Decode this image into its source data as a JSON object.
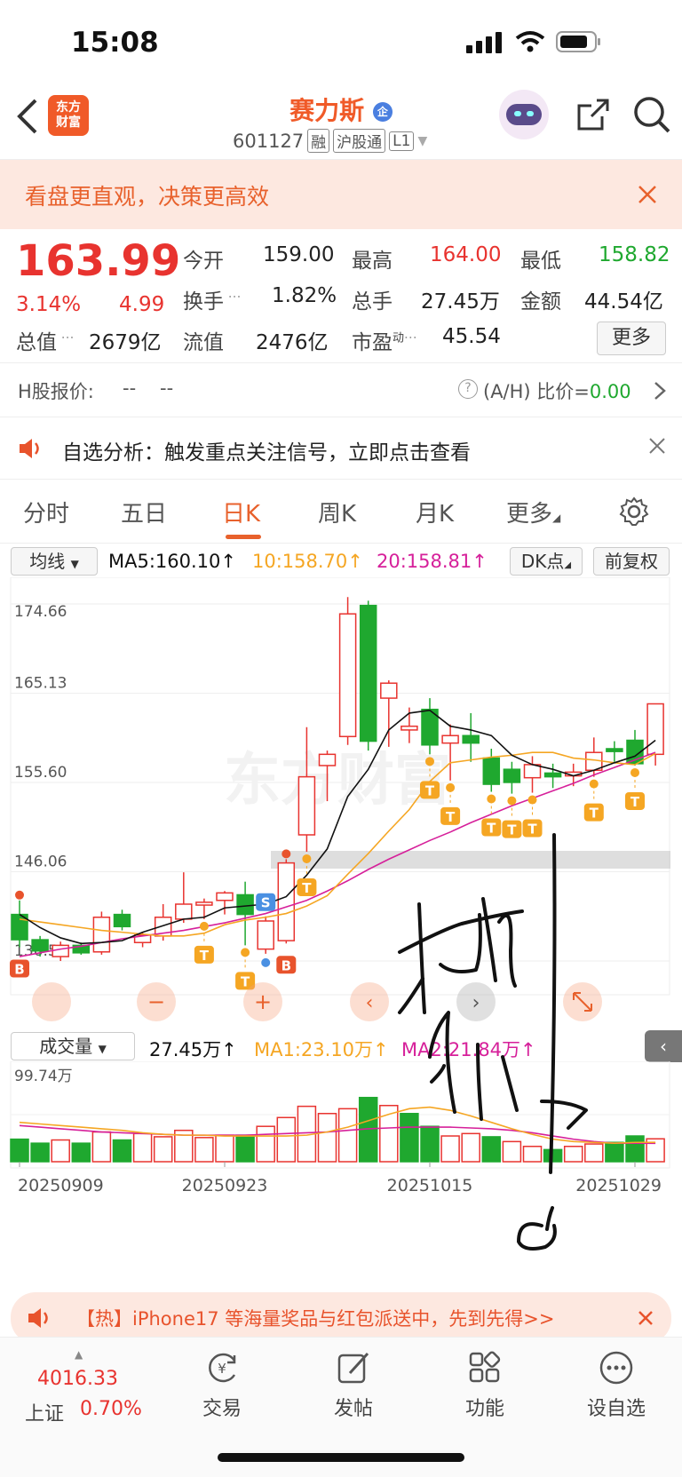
{
  "status": {
    "time": "15:08"
  },
  "header": {
    "app_logo": "东方\n财富",
    "stock_name": "赛力斯",
    "stock_badge": "企",
    "code": "601127",
    "tags": [
      "融",
      "沪股通",
      "L1"
    ]
  },
  "promo": {
    "text": "看盘更直观，决策更高效"
  },
  "quote": {
    "price": "163.99",
    "change_pct": "3.14%",
    "change": "4.99",
    "open_label": "今开",
    "open": "159.00",
    "high_label": "最高",
    "high": "164.00",
    "low_label": "最低",
    "low": "158.82",
    "turnover_label": "换手",
    "turnover": "1.82%",
    "volume_label": "总手",
    "volume": "27.45万",
    "amount_label": "金额",
    "amount": "44.54亿",
    "mktcap_label": "总值",
    "mktcap": "2679亿",
    "float_label": "流值",
    "float": "2476亿",
    "pe_label": "市盈",
    "pe_sup": "动",
    "pe": "45.54",
    "more_label": "更多"
  },
  "hk": {
    "label": "H股报价:",
    "value": "--",
    "value2": "--",
    "ratio_label": "(A/H) 比价=",
    "ratio": "0.00"
  },
  "alert": {
    "text": "自选分析：触发重点关注信号，立即点击查看"
  },
  "tabs": [
    "分时",
    "五日",
    "日K",
    "周K",
    "月K",
    "更多"
  ],
  "active_tab": "日K",
  "ma_bar": {
    "selector": "均线",
    "ma5": "MA5:160.10",
    "ma10": "10:158.70",
    "ma20": "20:158.81",
    "dk": "DK点",
    "adjust": "前复权"
  },
  "vol_bar": {
    "selector": "成交量",
    "vol": "27.45万",
    "ma1": "MA1:23.10万",
    "ma2": "MA2:21.84万"
  },
  "chart_data": [
    {
      "type": "candlestick",
      "y_ticks": [
        "174.66",
        "165.13",
        "155.60",
        "146.06",
        "136.53"
      ],
      "ylim": [
        136.53,
        174.66
      ],
      "colors": {
        "up": "#e8332f",
        "down": "#1fa82f",
        "ma5": "#111111",
        "ma10": "#f5a623",
        "ma20": "#d6209a"
      },
      "candles": [
        {
          "o": 141.5,
          "h": 143.0,
          "l": 138.0,
          "c": 138.8
        },
        {
          "o": 138.8,
          "h": 139.2,
          "l": 137.0,
          "c": 137.6
        },
        {
          "o": 137.0,
          "h": 138.6,
          "l": 136.53,
          "c": 138.2
        },
        {
          "o": 138.2,
          "h": 138.5,
          "l": 137.2,
          "c": 137.4
        },
        {
          "o": 137.5,
          "h": 141.8,
          "l": 137.2,
          "c": 141.2
        },
        {
          "o": 141.5,
          "h": 142.0,
          "l": 139.8,
          "c": 140.2
        },
        {
          "o": 138.5,
          "h": 139.6,
          "l": 138.0,
          "c": 139.3
        },
        {
          "o": 139.2,
          "h": 142.6,
          "l": 138.7,
          "c": 141.2
        },
        {
          "o": 141.0,
          "h": 146.0,
          "l": 140.6,
          "c": 142.6
        },
        {
          "o": 142.5,
          "h": 143.2,
          "l": 141.0,
          "c": 142.8
        },
        {
          "o": 143.0,
          "h": 144.0,
          "l": 141.5,
          "c": 143.8
        },
        {
          "o": 143.6,
          "h": 145.0,
          "l": 138.2,
          "c": 141.5
        },
        {
          "o": 137.8,
          "h": 141.3,
          "l": 137.3,
          "c": 140.8
        },
        {
          "o": 138.7,
          "h": 147.4,
          "l": 138.4,
          "c": 147.0
        },
        {
          "o": 150.0,
          "h": 161.5,
          "l": 148.2,
          "c": 156.2
        },
        {
          "o": 157.4,
          "h": 159.0,
          "l": 153.6,
          "c": 158.6
        },
        {
          "o": 160.5,
          "h": 175.4,
          "l": 159.6,
          "c": 173.6
        },
        {
          "o": 174.5,
          "h": 175.0,
          "l": 159.0,
          "c": 160.0
        },
        {
          "o": 164.6,
          "h": 166.5,
          "l": 159.4,
          "c": 166.2
        },
        {
          "o": 161.2,
          "h": 163.6,
          "l": 159.8,
          "c": 161.6
        },
        {
          "o": 163.4,
          "h": 164.6,
          "l": 158.6,
          "c": 159.6
        },
        {
          "o": 159.8,
          "h": 161.8,
          "l": 155.8,
          "c": 160.6
        },
        {
          "o": 160.6,
          "h": 163.0,
          "l": 157.8,
          "c": 159.8
        },
        {
          "o": 158.2,
          "h": 159.2,
          "l": 154.6,
          "c": 155.4
        },
        {
          "o": 157.0,
          "h": 157.8,
          "l": 154.4,
          "c": 155.6
        },
        {
          "o": 156.1,
          "h": 158.4,
          "l": 154.5,
          "c": 157.5
        },
        {
          "o": 156.6,
          "h": 157.6,
          "l": 155.0,
          "c": 156.2
        },
        {
          "o": 156.3,
          "h": 157.6,
          "l": 155.2,
          "c": 156.7
        },
        {
          "o": 156.9,
          "h": 160.4,
          "l": 156.2,
          "c": 158.8
        },
        {
          "o": 159.2,
          "h": 160.0,
          "l": 157.8,
          "c": 158.9
        },
        {
          "o": 160.1,
          "h": 161.2,
          "l": 157.4,
          "c": 157.6
        },
        {
          "o": 158.6,
          "h": 164.0,
          "l": 157.4,
          "c": 163.99
        }
      ],
      "ma5": [
        141.5,
        140.1,
        139.0,
        138.4,
        138.5,
        138.7,
        139.6,
        140.3,
        141.0,
        141.2,
        142.2,
        142.4,
        142.6,
        143.4,
        145.7,
        148.5,
        154.1,
        157.0,
        161.2,
        163.0,
        163.3,
        161.6,
        161.2,
        160.6,
        158.5,
        157.5,
        157.0,
        156.3,
        156.9,
        157.7,
        158.4,
        160.1
      ],
      "ma10": [
        141.0,
        140.7,
        140.4,
        140.1,
        139.8,
        139.6,
        139.4,
        139.2,
        139.2,
        139.5,
        140.4,
        140.9,
        141.2,
        141.6,
        142.4,
        143.5,
        145.8,
        148.0,
        150.4,
        152.7,
        155.7,
        157.7,
        158.0,
        158.3,
        158.5,
        158.8,
        158.8,
        158.2,
        158.0,
        157.7,
        157.5,
        158.7
      ],
      "ma20": [
        137.0,
        137.4,
        137.8,
        138.1,
        138.5,
        138.9,
        139.2,
        139.5,
        139.8,
        140.2,
        140.6,
        141.1,
        141.6,
        142.3,
        143.0,
        144.0,
        145.1,
        146.3,
        147.4,
        148.4,
        149.4,
        150.3,
        151.3,
        152.2,
        153.1,
        153.9,
        154.7,
        155.5,
        156.4,
        157.2,
        158.0,
        158.81
      ],
      "markers": [
        {
          "type": "B",
          "index": 0
        },
        {
          "type": "S",
          "index": 12
        },
        {
          "type": "B",
          "index": 13
        },
        {
          "type": "T",
          "index": 9
        },
        {
          "type": "T",
          "index": 11
        },
        {
          "type": "T",
          "index": 14
        },
        {
          "type": "T",
          "index": 20
        },
        {
          "type": "T",
          "index": 21
        },
        {
          "type": "T",
          "index": 23
        },
        {
          "type": "T",
          "index": 24
        },
        {
          "type": "T",
          "index": 25
        },
        {
          "type": "T",
          "index": 28
        },
        {
          "type": "T",
          "index": 30
        }
      ]
    },
    {
      "type": "bar",
      "title": "成交量",
      "y_ticks": [
        "99.74万"
      ],
      "ylim": [
        0,
        99.74
      ],
      "x_ticks": [
        {
          "index": 0,
          "label": "20250909"
        },
        {
          "index": 10,
          "label": "20250923"
        },
        {
          "index": 20,
          "label": "20251015"
        },
        {
          "index": 30,
          "label": "20251029"
        }
      ],
      "values": [
        27,
        22,
        26,
        22,
        36,
        26,
        34,
        30,
        38,
        29,
        32,
        32,
        43,
        54,
        68,
        59,
        65,
        79,
        69,
        59,
        43,
        31,
        34,
        30,
        24,
        18,
        14,
        18,
        21,
        23,
        31,
        27.45
      ],
      "up": [
        false,
        false,
        true,
        false,
        true,
        false,
        true,
        true,
        true,
        true,
        true,
        false,
        true,
        true,
        true,
        true,
        true,
        false,
        true,
        false,
        false,
        true,
        true,
        false,
        true,
        true,
        false,
        true,
        true,
        false,
        false,
        true
      ],
      "ma1": [
        48,
        46,
        44,
        42,
        40,
        38,
        35,
        33,
        32,
        32,
        31,
        31,
        31,
        31,
        32,
        36,
        42,
        50,
        58,
        65,
        67,
        63,
        56,
        48,
        40,
        33,
        27,
        24,
        23,
        22,
        23,
        23.1
      ],
      "ma2": [
        44,
        42,
        40,
        38,
        36,
        35,
        34,
        33,
        32,
        32,
        32,
        32,
        33,
        34,
        35,
        36,
        38,
        40,
        41,
        42,
        42,
        42,
        41,
        40,
        38,
        35,
        31,
        27,
        24,
        22,
        22,
        21.84
      ]
    }
  ],
  "watermark": "东方财富",
  "banner2": {
    "text": "【热】iPhone17 等海量奖品与红包派送中，先到先得>>"
  },
  "bottom_nav": {
    "index_value": "4016.33",
    "index_name": "上证",
    "index_change": "0.70%",
    "items": [
      "交易",
      "发帖",
      "功能",
      "设自选"
    ]
  },
  "icons": [
    "back-icon",
    "verified-icon",
    "share-icon",
    "search-icon",
    "close-icon",
    "speaker-icon",
    "settings-icon",
    "expand-icon",
    "trade-icon",
    "post-icon",
    "apps-icon",
    "more-icon",
    "info-icon",
    "chevron-right-icon"
  ]
}
